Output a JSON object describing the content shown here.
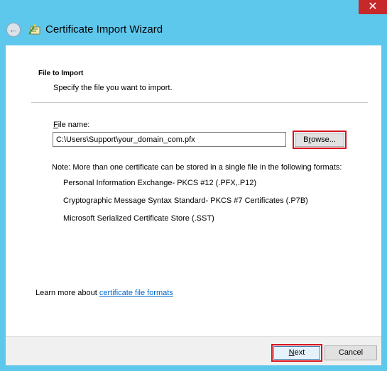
{
  "window": {
    "title": "Certificate Import Wizard",
    "close_glyph": "✕",
    "back_glyph": "←"
  },
  "section": {
    "title": "File to Import",
    "subtitle": "Specify the file you want to import."
  },
  "file": {
    "label_accel": "F",
    "label_rest": "ile name:",
    "value": "C:\\Users\\Support\\your_domain_com.pfx",
    "browse_accel": "r",
    "browse_before": "B",
    "browse_after": "owse..."
  },
  "note": {
    "text": "Note:  More than one certificate can be stored in a single file in the following formats:",
    "formats": [
      "Personal Information Exchange- PKCS #12 (.PFX,.P12)",
      "Cryptographic Message Syntax Standard- PKCS #7 Certificates (.P7B)",
      "Microsoft Serialized Certificate Store (.SST)"
    ]
  },
  "learn_more": {
    "prefix": "Learn more about ",
    "link": "certificate file formats"
  },
  "footer": {
    "next_accel": "N",
    "next_rest": "ext",
    "cancel_label": "Cancel"
  },
  "colors": {
    "window_frame": "#5ec7ec",
    "close_button": "#c7282a",
    "highlight_box": "#d6121e",
    "link": "#0066cc"
  }
}
